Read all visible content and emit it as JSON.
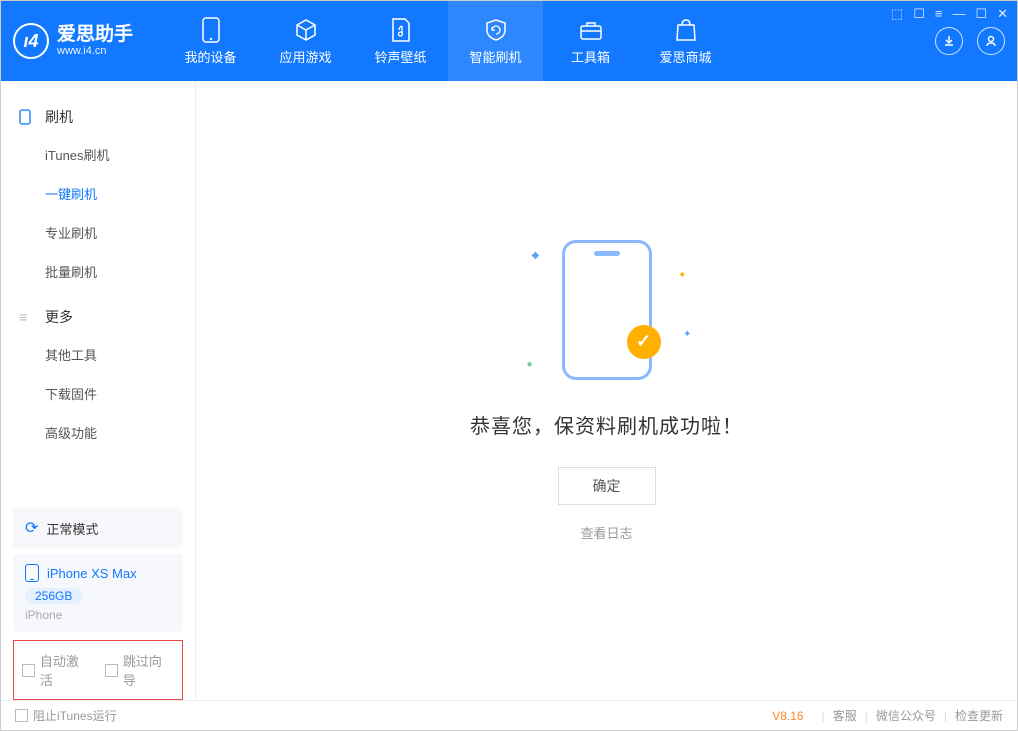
{
  "app": {
    "title": "爱思助手",
    "subtitle": "www.i4.cn"
  },
  "nav": {
    "tabs": [
      {
        "label": "我的设备"
      },
      {
        "label": "应用游戏"
      },
      {
        "label": "铃声壁纸"
      },
      {
        "label": "智能刷机"
      },
      {
        "label": "工具箱"
      },
      {
        "label": "爱思商城"
      }
    ]
  },
  "sidebar": {
    "section1": {
      "title": "刷机",
      "items": [
        "iTunes刷机",
        "一键刷机",
        "专业刷机",
        "批量刷机"
      ]
    },
    "section2": {
      "title": "更多",
      "items": [
        "其他工具",
        "下载固件",
        "高级功能"
      ]
    },
    "mode": "正常模式",
    "device": {
      "name": "iPhone XS Max",
      "capacity": "256GB",
      "type": "iPhone"
    },
    "checkboxes": {
      "auto_activate": "自动激活",
      "skip_guide": "跳过向导"
    }
  },
  "main": {
    "success_text": "恭喜您，保资料刷机成功啦！",
    "ok_button": "确定",
    "view_log": "查看日志"
  },
  "footer": {
    "block_itunes": "阻止iTunes运行",
    "version": "V8.16",
    "links": [
      "客服",
      "微信公众号",
      "检查更新"
    ]
  }
}
